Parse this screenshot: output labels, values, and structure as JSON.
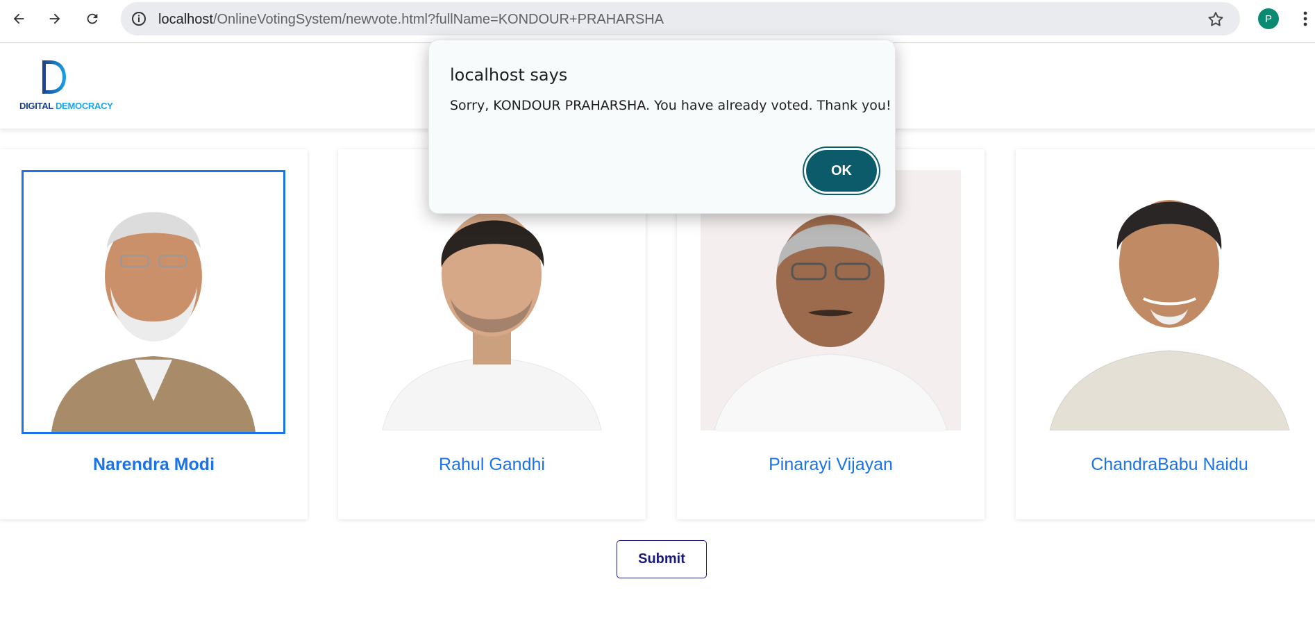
{
  "browser": {
    "url_host": "localhost",
    "url_path": "/OnlineVotingSystem/newvote.html?fullName=KONDOUR+PRAHARSHA",
    "profile_initial": "P"
  },
  "site": {
    "logo_text_part1": "DIGITAL ",
    "logo_text_part2": "DEMOCRACY"
  },
  "candidates": [
    {
      "name": "Narendra Modi",
      "selected": true
    },
    {
      "name": "Rahul Gandhi",
      "selected": false
    },
    {
      "name": "Pinarayi Vijayan",
      "selected": false
    },
    {
      "name": "ChandraBabu Naidu",
      "selected": false
    }
  ],
  "submit_label": "Submit",
  "dialog": {
    "title": "localhost says",
    "message": "Sorry, KONDOUR PRAHARSHA. You have already voted. Thank you!",
    "ok_label": "OK"
  },
  "colors": {
    "accent": "#1a73e8",
    "dialog_button": "#0b5b6b",
    "submit_border": "#1a1a7a"
  }
}
